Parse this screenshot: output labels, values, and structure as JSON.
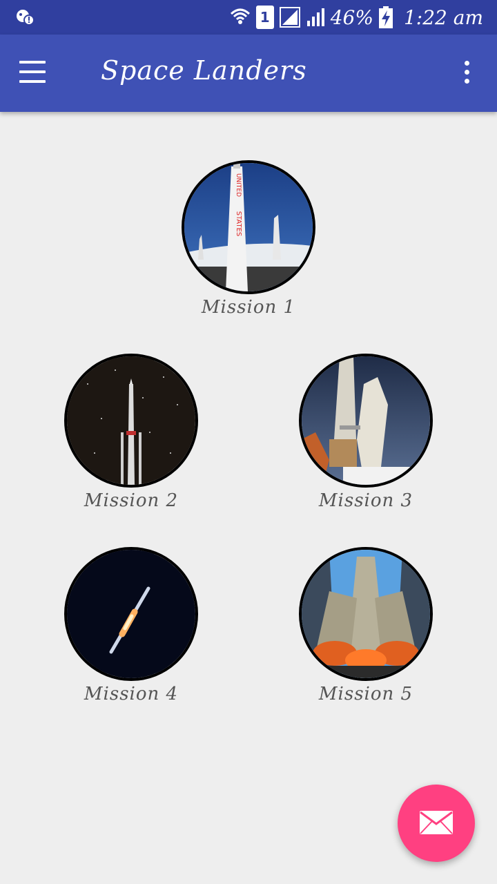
{
  "status_bar": {
    "sim_badge": "1",
    "battery_percent": "46%",
    "time": "1:22 am",
    "icons": [
      "notification-icon",
      "wifi-icon",
      "sim-icon",
      "signal-icon",
      "battery-charging-icon"
    ]
  },
  "app_bar": {
    "title": "Space Landers",
    "icons": [
      "menu-icon",
      "more-vert-icon"
    ]
  },
  "missions": [
    {
      "label": "Mission 1"
    },
    {
      "label": "Mission 2"
    },
    {
      "label": "Mission 3"
    },
    {
      "label": "Mission 4"
    },
    {
      "label": "Mission 5"
    }
  ],
  "fab": {
    "icon": "email-icon",
    "color": "#ff4081"
  },
  "colors": {
    "status_bar": "#303f9f",
    "app_bar": "#3f51b5",
    "background": "#eeeeee",
    "accent": "#ff4081"
  }
}
